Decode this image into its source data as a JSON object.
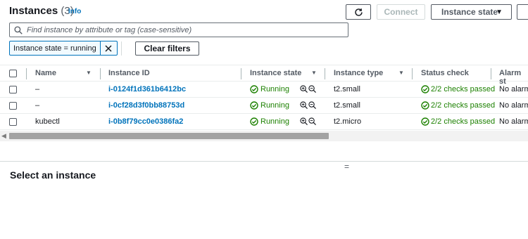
{
  "header": {
    "title": "Instances",
    "count": "(3)",
    "info": "Info"
  },
  "toolbar": {
    "connect_label": "Connect",
    "instance_state_label": "Instance state"
  },
  "search": {
    "placeholder": "Find instance by attribute or tag (case-sensitive)",
    "value": ""
  },
  "filters": {
    "token_label": "Instance state = running",
    "clear_label": "Clear filters"
  },
  "table": {
    "columns": [
      "Name",
      "Instance ID",
      "Instance state",
      "Instance type",
      "Status check",
      "Alarm st"
    ],
    "rows": [
      {
        "name": "–",
        "id": "i-0124f1d361b6412bc",
        "state": "Running",
        "type": "t2.small",
        "status": "2/2 checks passed",
        "alarm": "No alarm"
      },
      {
        "name": "–",
        "id": "i-0cf28d3f0bb88753d",
        "state": "Running",
        "type": "t2.small",
        "status": "2/2 checks passed",
        "alarm": "No alarm"
      },
      {
        "name": "kubectl",
        "id": "i-0b8f79cc0e0386fa2",
        "state": "Running",
        "type": "t2.micro",
        "status": "2/2 checks passed",
        "alarm": "No alarm"
      }
    ]
  },
  "details": {
    "handle": "=",
    "title": "Select an instance"
  },
  "colors": {
    "link": "#0073bb",
    "success": "#1d8102"
  }
}
